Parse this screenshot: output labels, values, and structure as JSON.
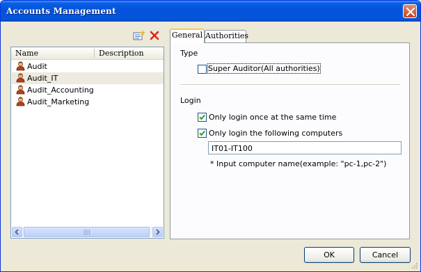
{
  "window": {
    "title": "Accounts Management"
  },
  "toolbar": {
    "add_icon": "add-account-icon",
    "delete_icon": "delete-icon"
  },
  "accounts_list": {
    "columns": [
      "Name",
      "Description"
    ],
    "items": [
      {
        "name": "Audit",
        "description": "",
        "selected": false
      },
      {
        "name": "Audit_IT",
        "description": "",
        "selected": true
      },
      {
        "name": "Audit_Accounting",
        "description": "",
        "selected": false
      },
      {
        "name": "Audit_Marketing",
        "description": "",
        "selected": false
      }
    ]
  },
  "tabs": [
    {
      "label": "General",
      "active": true
    },
    {
      "label": "Authorities",
      "active": false
    }
  ],
  "general": {
    "type_section": "Type",
    "super_auditor_label": "Super Auditor(All authorities)",
    "super_auditor_checked": false,
    "login_section": "Login",
    "login_once_label": "Only login once at the same time",
    "login_once_checked": true,
    "login_computers_label": "Only login the following computers",
    "login_computers_checked": true,
    "computers_value": "IT01-IT100",
    "hint": "* Input computer name(example: \"pc-1,pc-2\")"
  },
  "buttons": {
    "ok": "OK",
    "cancel": "Cancel"
  },
  "colors": {
    "titlebar": "#0453dc",
    "selected_row": "#edeae0",
    "tab_highlight": "#ffc83c"
  }
}
